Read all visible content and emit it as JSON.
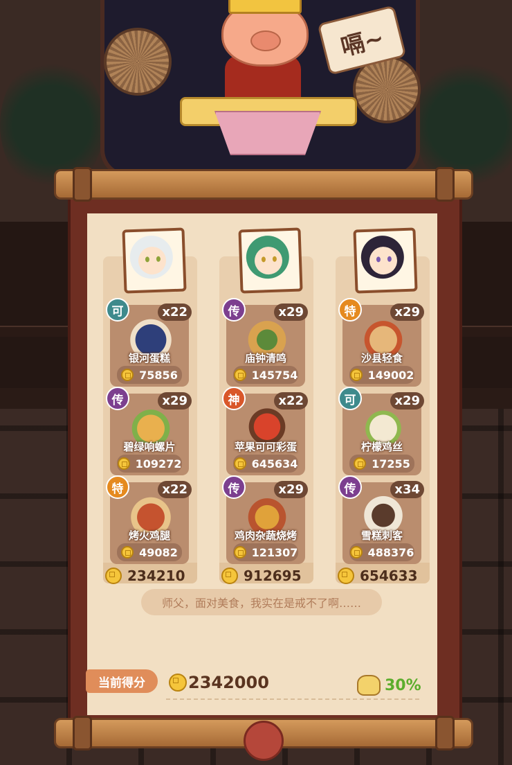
{
  "boss": {
    "bubble_text": "嗝~"
  },
  "columns": [
    {
      "total": "234210",
      "dishes": [
        {
          "badge": "可",
          "badge_color": "#3e8a8c",
          "qty": "x22",
          "name": "银河蛋糕",
          "score": "75856"
        },
        {
          "badge": "传",
          "badge_color": "#7c3f8f",
          "qty": "x29",
          "name": "碧绿响螺片",
          "score": "109272"
        },
        {
          "badge": "特",
          "badge_color": "#e58a1f",
          "qty": "x22",
          "name": "烤火鸡腿",
          "score": "49082"
        }
      ]
    },
    {
      "total": "912695",
      "dishes": [
        {
          "badge": "传",
          "badge_color": "#7c3f8f",
          "qty": "x29",
          "name": "庙钟清鸣",
          "score": "145754"
        },
        {
          "badge": "神",
          "badge_color": "#d9572a",
          "qty": "x22",
          "name": "苹果可可彩蛋",
          "score": "645634"
        },
        {
          "badge": "传",
          "badge_color": "#7c3f8f",
          "qty": "x29",
          "name": "鸡肉杂蔬烧烤",
          "score": "121307"
        }
      ]
    },
    {
      "total": "654633",
      "dishes": [
        {
          "badge": "特",
          "badge_color": "#e58a1f",
          "qty": "x29",
          "name": "沙县轻食",
          "score": "149002"
        },
        {
          "badge": "可",
          "badge_color": "#3e8a8c",
          "qty": "x29",
          "name": "柠檬鸡丝",
          "score": "17255"
        },
        {
          "badge": "传",
          "badge_color": "#7c3f8f",
          "qty": "x34",
          "name": "雪糕刺客",
          "score": "488376"
        }
      ]
    }
  ],
  "quote": "师父，面对美食，我实在是戒不了啊……",
  "footer": {
    "current_label": "当前得分",
    "current_score": "2342000",
    "percent": "30%"
  }
}
